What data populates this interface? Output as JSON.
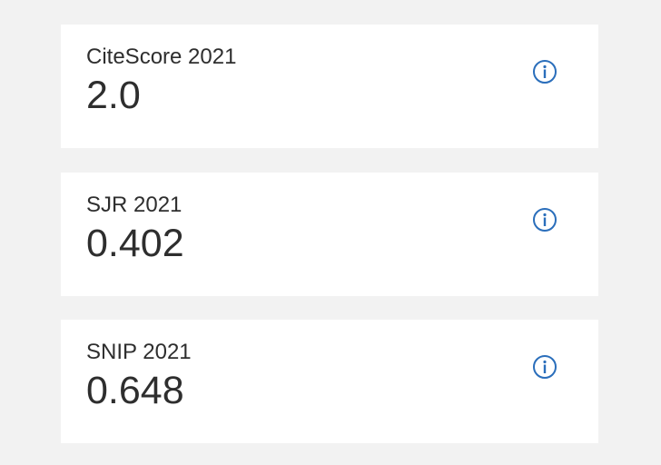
{
  "metrics": [
    {
      "label": "CiteScore 2021",
      "value": "2.0",
      "icon": "info-icon"
    },
    {
      "label": "SJR 2021",
      "value": "0.402",
      "icon": "info-icon"
    },
    {
      "label": "SNIP 2021",
      "value": "0.648",
      "icon": "info-icon"
    }
  ],
  "colors": {
    "background": "#f2f2f2",
    "card": "#ffffff",
    "text": "#2e2e2e",
    "info_icon": "#2a6ebb"
  }
}
